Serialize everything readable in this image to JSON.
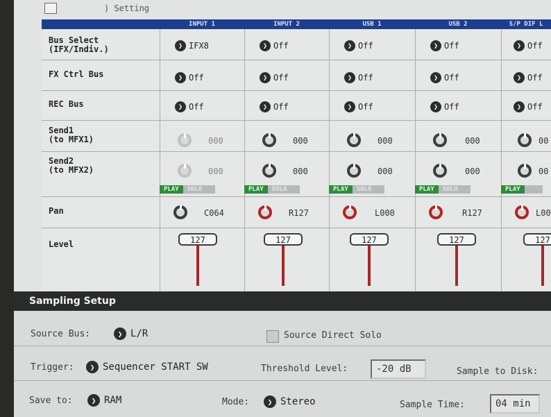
{
  "tab": {
    "partial_label": ") Setting"
  },
  "channels": [
    {
      "name": "INPUT 1",
      "bus_select": "IFX8",
      "fx_ctrl_bus": "Off",
      "rec_bus": "Off",
      "send1": "000",
      "send2": "000",
      "pan": "C064",
      "level": "127",
      "play": "PLAY",
      "solo": "SOLO"
    },
    {
      "name": "INPUT 2",
      "bus_select": "Off",
      "fx_ctrl_bus": "Off",
      "rec_bus": "Off",
      "send1": "000",
      "send2": "000",
      "pan": "R127",
      "level": "127",
      "play": "PLAY",
      "solo": "SOLO"
    },
    {
      "name": "USB 1",
      "bus_select": "Off",
      "fx_ctrl_bus": "Off",
      "rec_bus": "Off",
      "send1": "000",
      "send2": "000",
      "pan": "L000",
      "level": "127",
      "play": "PLAY",
      "solo": "SOLO"
    },
    {
      "name": "USB 2",
      "bus_select": "Off",
      "fx_ctrl_bus": "Off",
      "rec_bus": "Off",
      "send1": "000",
      "send2": "000",
      "pan": "R127",
      "level": "127",
      "play": "PLAY",
      "solo": "SOLO"
    },
    {
      "name": "S/P DIF L",
      "bus_select": "Off",
      "fx_ctrl_bus": "Off",
      "rec_bus": "Off",
      "send1": "00",
      "send2": "00",
      "pan": "L00",
      "level": "127",
      "play": "PLAY",
      "solo": ""
    }
  ],
  "row_labels": {
    "bus_select_1": "Bus Select",
    "bus_select_2": "(IFX/Indiv.)",
    "fx_ctrl_bus": "FX Ctrl Bus",
    "rec_bus": "REC Bus",
    "send1_1": "Send1",
    "send1_2": "(to MFX1)",
    "send2_1": "Send2",
    "send2_2": "(to MFX2)",
    "pan": "Pan",
    "level": "Level"
  },
  "sampling": {
    "title": "Sampling Setup",
    "source_bus_label": "Source Bus:",
    "source_bus_value": "L/R",
    "source_direct_solo_label": "Source Direct Solo",
    "trigger_label": "Trigger:",
    "trigger_value": "Sequencer START SW",
    "threshold_label": "Threshold Level:",
    "threshold_value": "-20 dB",
    "sample_to_disk_label": "Sample to Disk:",
    "save_to_label": "Save to:",
    "save_to_value": "RAM",
    "mode_label": "Mode:",
    "mode_value": "Stereo",
    "sample_time_label": "Sample Time:",
    "sample_time_value": "04 min"
  },
  "colors": {
    "header_blue": "#1c3e8c",
    "play_green": "#2f8c3d",
    "pan_red": "#b32423",
    "fader_red": "#a7262a",
    "section_dark": "#2a2b2d"
  }
}
